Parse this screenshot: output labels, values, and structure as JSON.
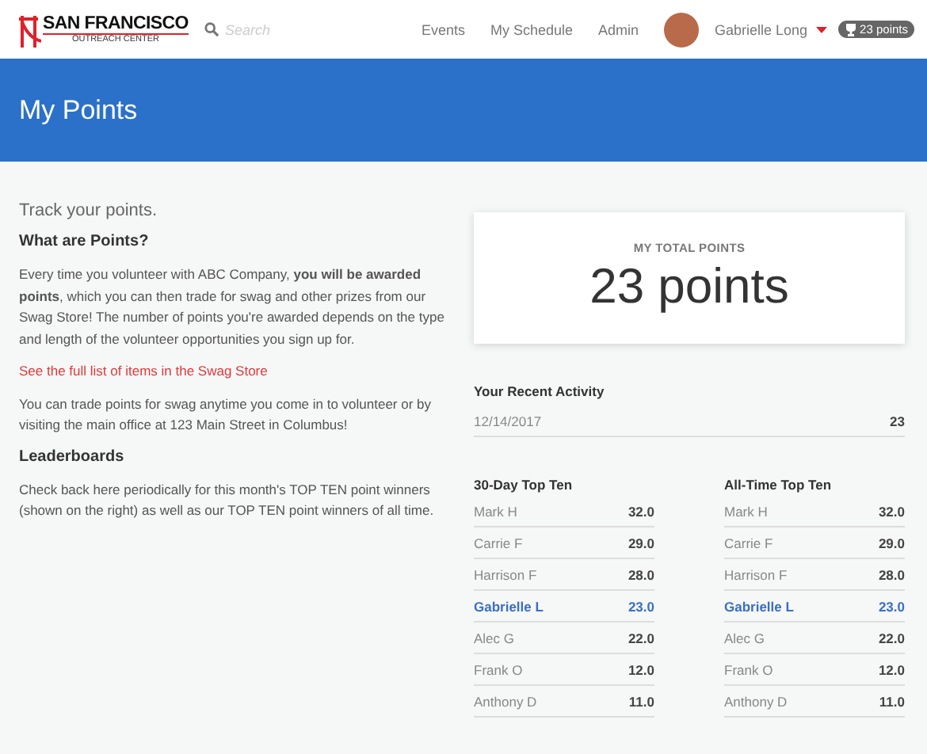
{
  "header": {
    "logo": {
      "title": "SAN FRANCISCO",
      "subtitle": "OUTREACH CENTER"
    },
    "search": {
      "placeholder": "Search"
    },
    "nav": [
      "Events",
      "My Schedule",
      "Admin"
    ],
    "user": {
      "name": "Gabrielle Long"
    },
    "points_badge": "23 points"
  },
  "banner": {
    "title": "My Points"
  },
  "intro": {
    "tagline": "Track your points.",
    "sections": [
      {
        "heading": "What are Points?",
        "paragraphs": [
          {
            "kind": "text",
            "text": "Every time you volunteer with ABC Company, **you will be awarded points**, which you can then trade for swag and other prizes from our Swag Store! The number of points you're awarded depends on the type and length of the volunteer opportunities you sign up for."
          },
          {
            "kind": "link",
            "text": "See the full list of items in the Swag Store"
          },
          {
            "kind": "text",
            "text": "You can trade points for swag anytime you come in to volunteer or by visiting the main office at 123 Main Street in Columbus!"
          }
        ]
      },
      {
        "heading": "Leaderboards",
        "paragraphs": [
          {
            "kind": "text",
            "text": "Check back here periodically for this month's TOP TEN point winners (shown on the right) as well as our TOP TEN point winners of all time."
          }
        ]
      }
    ]
  },
  "total_card": {
    "label": "MY TOTAL POINTS",
    "value": "23 points"
  },
  "recent_activity": {
    "title": "Your Recent Activity",
    "rows": [
      {
        "date": "12/14/2017",
        "points": "23"
      }
    ]
  },
  "leaderboards": [
    {
      "title": "30-Day Top Ten",
      "rows": [
        {
          "name": "Mark H",
          "points": "32.0",
          "highlighted": false
        },
        {
          "name": "Carrie F",
          "points": "29.0",
          "highlighted": false
        },
        {
          "name": "Harrison F",
          "points": "28.0",
          "highlighted": false
        },
        {
          "name": "Gabrielle L",
          "points": "23.0",
          "highlighted": true
        },
        {
          "name": "Alec G",
          "points": "22.0",
          "highlighted": false
        },
        {
          "name": "Frank O",
          "points": "12.0",
          "highlighted": false
        },
        {
          "name": "Anthony D",
          "points": "11.0",
          "highlighted": false
        }
      ]
    },
    {
      "title": "All-Time Top Ten",
      "rows": [
        {
          "name": "Mark H",
          "points": "32.0",
          "highlighted": false
        },
        {
          "name": "Carrie F",
          "points": "29.0",
          "highlighted": false
        },
        {
          "name": "Harrison F",
          "points": "28.0",
          "highlighted": false
        },
        {
          "name": "Gabrielle L",
          "points": "23.0",
          "highlighted": true
        },
        {
          "name": "Alec G",
          "points": "22.0",
          "highlighted": false
        },
        {
          "name": "Frank O",
          "points": "12.0",
          "highlighted": false
        },
        {
          "name": "Anthony D",
          "points": "11.0",
          "highlighted": false
        }
      ]
    }
  ]
}
